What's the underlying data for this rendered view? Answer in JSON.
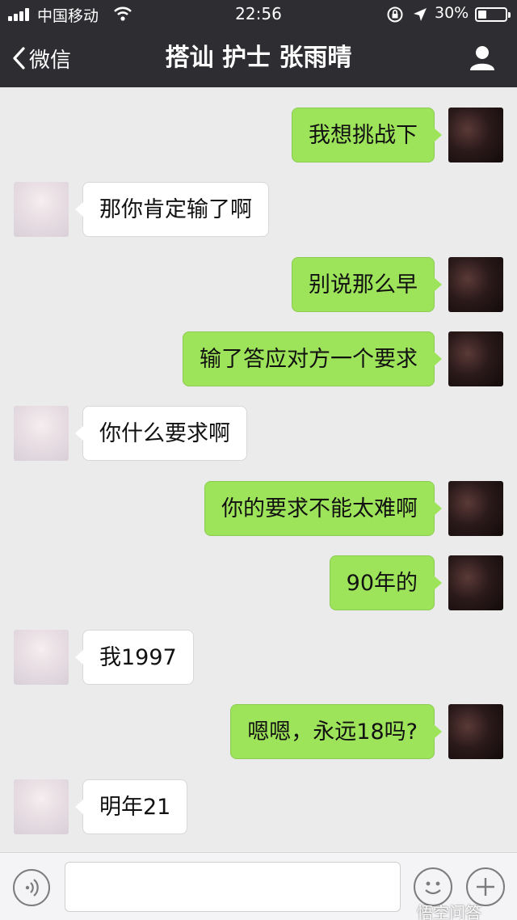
{
  "status_bar": {
    "carrier": "中国移动",
    "time": "22:56",
    "battery": "30%",
    "battery_level": 0.3
  },
  "nav": {
    "back_label": "微信",
    "title": "搭讪 护士 张雨晴"
  },
  "messages": [
    {
      "side": "out",
      "text": "我想挑战下"
    },
    {
      "side": "in",
      "text": "那你肯定输了啊"
    },
    {
      "side": "out",
      "text": "别说那么早"
    },
    {
      "side": "out",
      "text": "输了答应对方一个要求"
    },
    {
      "side": "in",
      "text": "你什么要求啊"
    },
    {
      "side": "out",
      "text": "你的要求不能太难啊"
    },
    {
      "side": "out",
      "text": "90年的"
    },
    {
      "side": "in",
      "text": "我1997"
    },
    {
      "side": "out",
      "text": "嗯嗯，永远18吗?"
    },
    {
      "side": "in",
      "text": "明年21"
    }
  ],
  "input": {
    "placeholder": ""
  },
  "watermark": "悟空问答",
  "colors": {
    "nav_bg": "#2e2e32",
    "outgoing_bubble": "#9ee45b",
    "incoming_bubble": "#ffffff",
    "chat_bg": "#ebebeb"
  }
}
